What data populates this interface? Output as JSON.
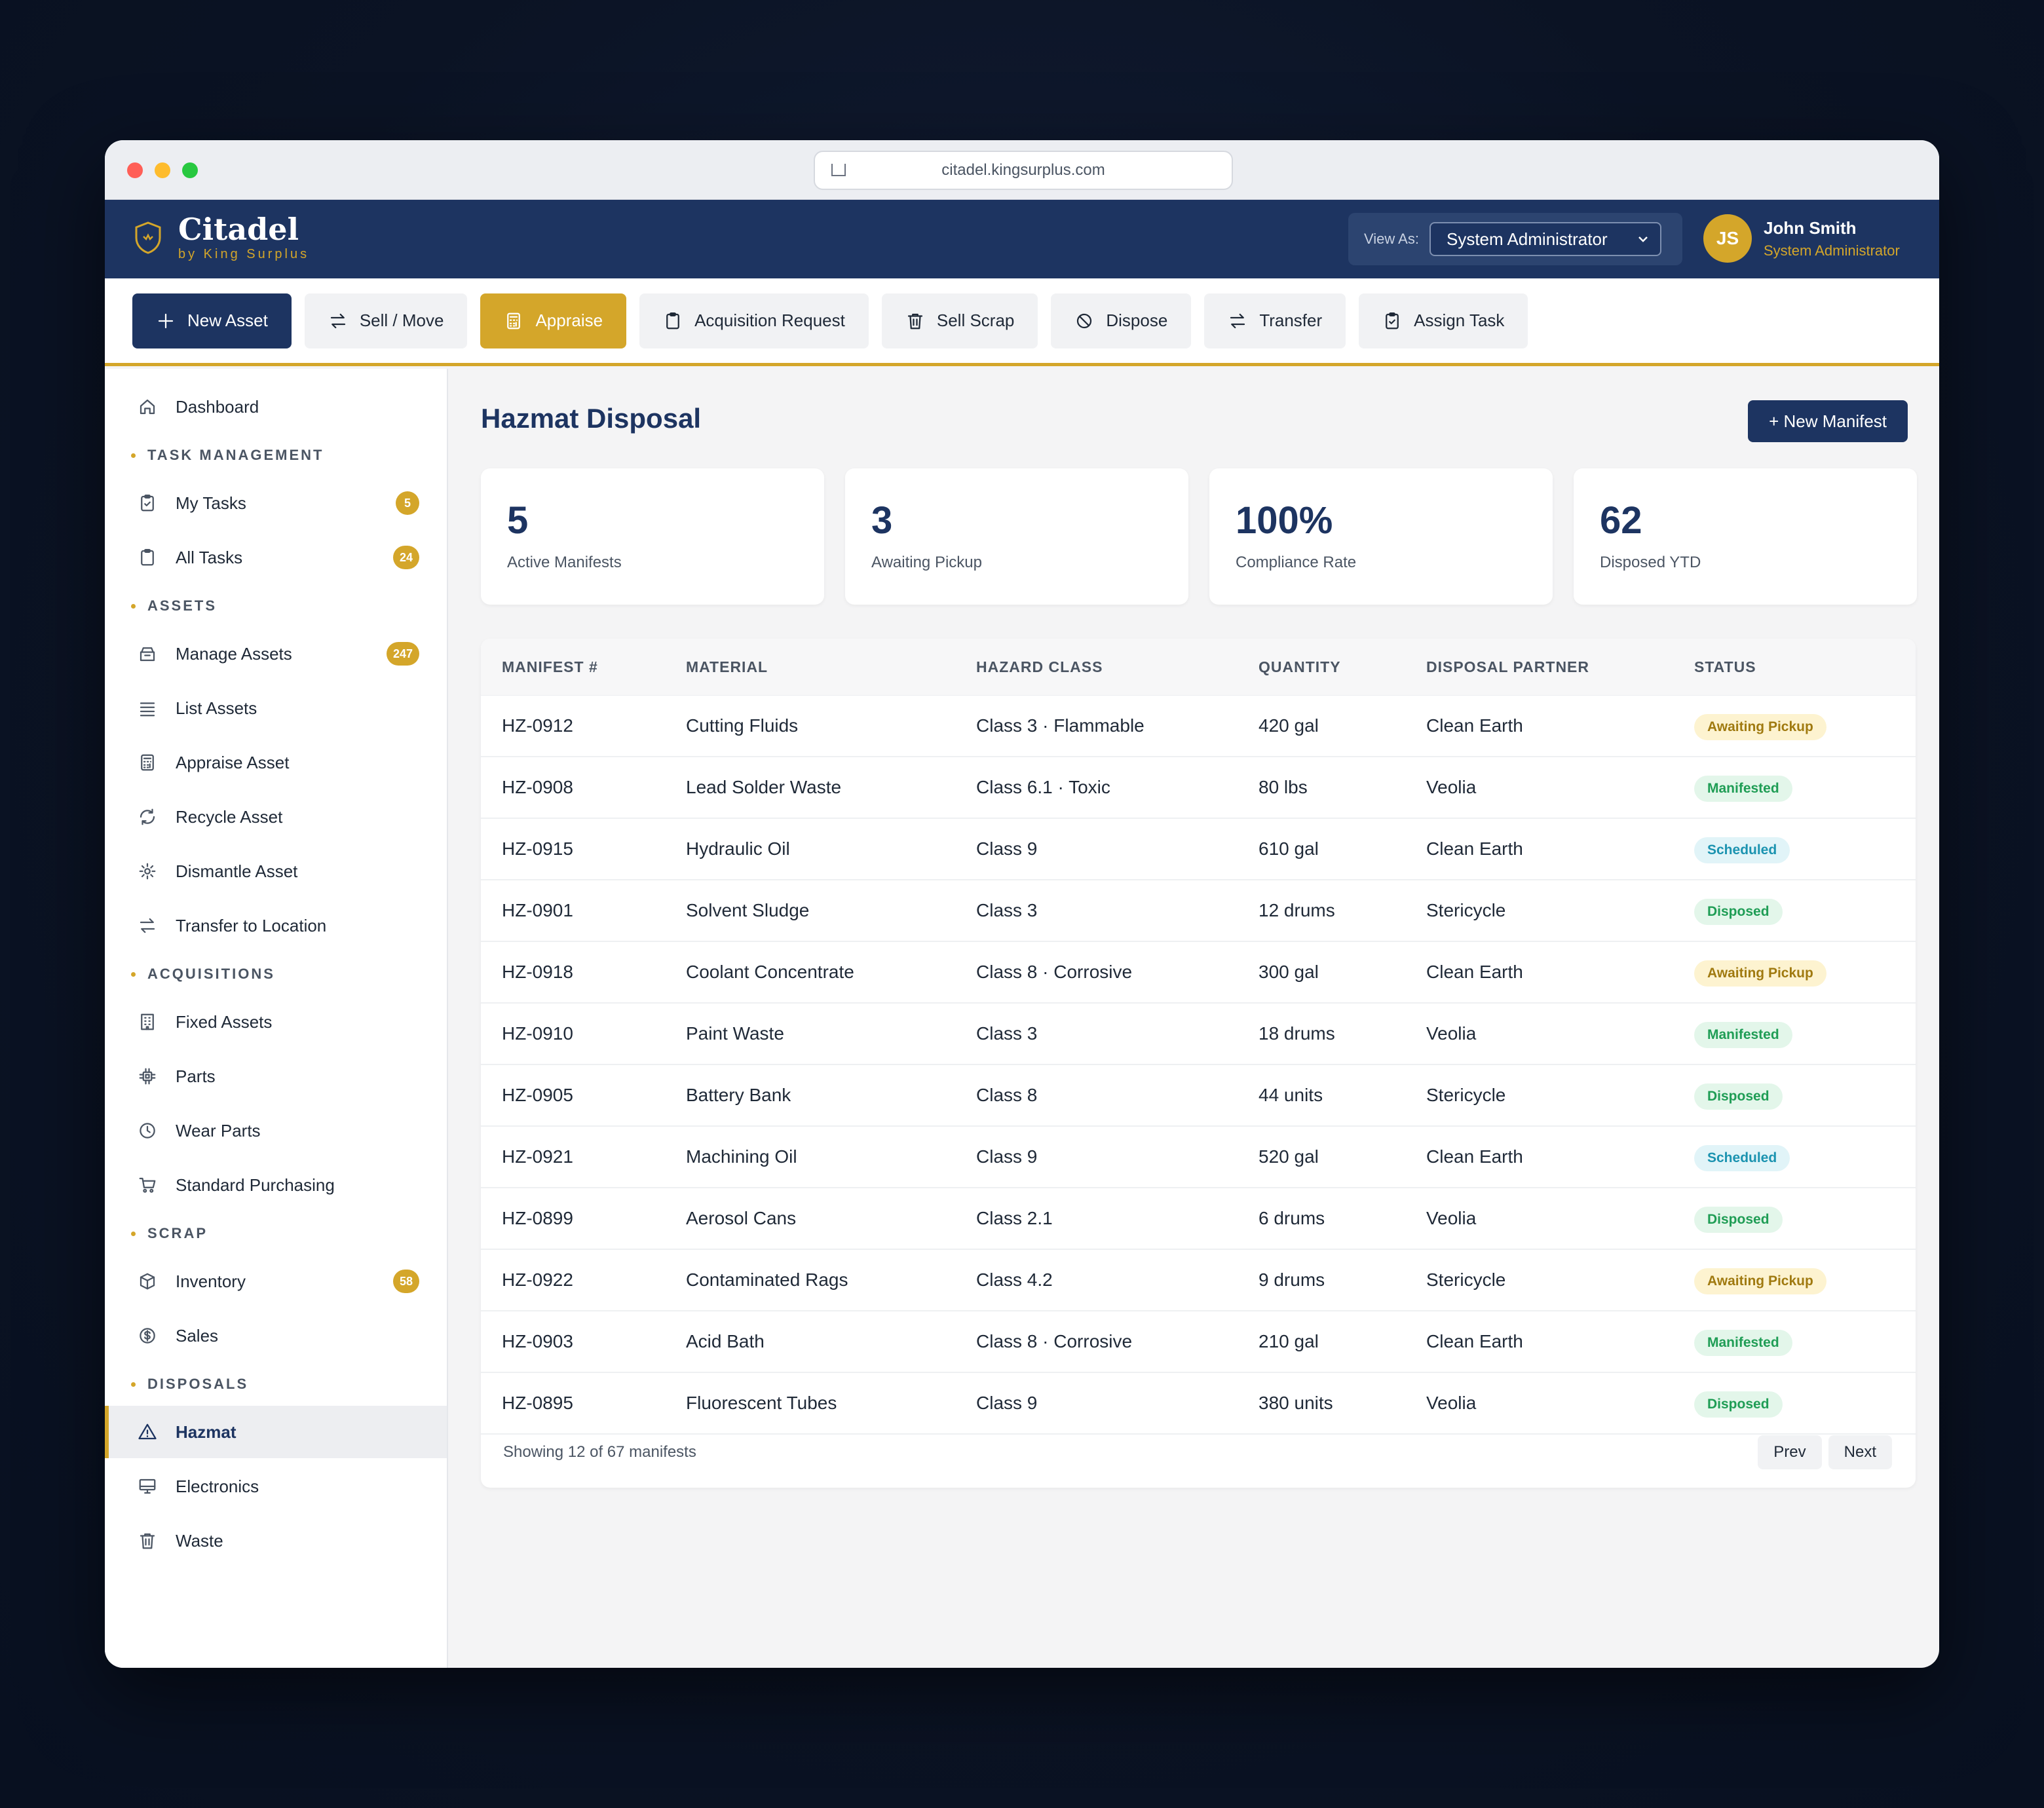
{
  "browser": {
    "url": "citadel.kingsurplus.com"
  },
  "header": {
    "brand_name": "Citadel",
    "brand_sub": "by King Surplus",
    "view_as_label": "View As:",
    "view_as_value": "System Administrator",
    "user_initials": "JS",
    "user_name": "John Smith",
    "user_role": "System Administrator"
  },
  "toolbar": [
    {
      "label": "New Asset",
      "icon": "plus-icon",
      "style": "primary"
    },
    {
      "label": "Sell / Move",
      "icon": "swap-icon",
      "style": "default"
    },
    {
      "label": "Appraise",
      "icon": "calculator-icon",
      "style": "gold"
    },
    {
      "label": "Acquisition Request",
      "icon": "clipboard-icon",
      "style": "default"
    },
    {
      "label": "Sell Scrap",
      "icon": "trash-icon",
      "style": "default"
    },
    {
      "label": "Dispose",
      "icon": "ban-icon",
      "style": "default"
    },
    {
      "label": "Transfer",
      "icon": "swap-icon",
      "style": "default"
    },
    {
      "label": "Assign Task",
      "icon": "clipboard-check-icon",
      "style": "default"
    }
  ],
  "sidebar": {
    "dashboard": "Dashboard",
    "sections": [
      {
        "title": "TASK MANAGEMENT",
        "items": [
          {
            "label": "My Tasks",
            "icon": "clipboard-check-icon",
            "badge": "5"
          },
          {
            "label": "All Tasks",
            "icon": "clipboard-icon",
            "badge": "24"
          }
        ]
      },
      {
        "title": "ASSETS",
        "items": [
          {
            "label": "Manage Assets",
            "icon": "archive-icon",
            "badge": "247"
          },
          {
            "label": "List Assets",
            "icon": "list-icon"
          },
          {
            "label": "Appraise Asset",
            "icon": "calculator-icon"
          },
          {
            "label": "Recycle Asset",
            "icon": "recycle-icon"
          },
          {
            "label": "Dismantle Asset",
            "icon": "gear-icon"
          },
          {
            "label": "Transfer to Location",
            "icon": "swap-icon"
          }
        ]
      },
      {
        "title": "ACQUISITIONS",
        "items": [
          {
            "label": "Fixed Assets",
            "icon": "building-icon"
          },
          {
            "label": "Parts",
            "icon": "chip-icon"
          },
          {
            "label": "Wear Parts",
            "icon": "clock-icon"
          },
          {
            "label": "Standard Purchasing",
            "icon": "cart-icon"
          }
        ]
      },
      {
        "title": "SCRAP",
        "items": [
          {
            "label": "Inventory",
            "icon": "box-icon",
            "badge": "58"
          },
          {
            "label": "Sales",
            "icon": "dollar-icon"
          }
        ]
      },
      {
        "title": "DISPOSALS",
        "items": [
          {
            "label": "Hazmat",
            "icon": "warning-icon",
            "active": true
          },
          {
            "label": "Electronics",
            "icon": "monitor-icon"
          },
          {
            "label": "Waste",
            "icon": "trash-icon"
          }
        ]
      }
    ]
  },
  "page": {
    "title": "Hazmat Disposal",
    "new_manifest_label": "+ New Manifest",
    "stats": [
      {
        "value": "5",
        "label": "Active Manifests"
      },
      {
        "value": "3",
        "label": "Awaiting Pickup"
      },
      {
        "value": "100%",
        "label": "Compliance Rate"
      },
      {
        "value": "62",
        "label": "Disposed YTD"
      }
    ]
  },
  "table": {
    "columns": [
      "MANIFEST #",
      "MATERIAL",
      "HAZARD CLASS",
      "QUANTITY",
      "DISPOSAL PARTNER",
      "STATUS"
    ],
    "rows": [
      [
        "HZ-0912",
        "Cutting Fluids",
        "Class 3 · Flammable",
        "420 gal",
        "Clean Earth",
        "Awaiting Pickup"
      ],
      [
        "HZ-0908",
        "Lead Solder Waste",
        "Class 6.1 · Toxic",
        "80 lbs",
        "Veolia",
        "Manifested"
      ],
      [
        "HZ-0915",
        "Hydraulic Oil",
        "Class 9",
        "610 gal",
        "Clean Earth",
        "Scheduled"
      ],
      [
        "HZ-0901",
        "Solvent Sludge",
        "Class 3",
        "12 drums",
        "Stericycle",
        "Disposed"
      ],
      [
        "HZ-0918",
        "Coolant Concentrate",
        "Class 8 · Corrosive",
        "300 gal",
        "Clean Earth",
        "Awaiting Pickup"
      ],
      [
        "HZ-0910",
        "Paint Waste",
        "Class 3",
        "18 drums",
        "Veolia",
        "Manifested"
      ],
      [
        "HZ-0905",
        "Battery Bank",
        "Class 8",
        "44 units",
        "Stericycle",
        "Disposed"
      ],
      [
        "HZ-0921",
        "Machining Oil",
        "Class 9",
        "520 gal",
        "Clean Earth",
        "Scheduled"
      ],
      [
        "HZ-0899",
        "Aerosol Cans",
        "Class 2.1",
        "6 drums",
        "Veolia",
        "Disposed"
      ],
      [
        "HZ-0922",
        "Contaminated Rags",
        "Class 4.2",
        "9 drums",
        "Stericycle",
        "Awaiting Pickup"
      ],
      [
        "HZ-0903",
        "Acid Bath",
        "Class 8 · Corrosive",
        "210 gal",
        "Clean Earth",
        "Manifested"
      ],
      [
        "HZ-0895",
        "Fluorescent Tubes",
        "Class 9",
        "380 units",
        "Veolia",
        "Disposed"
      ]
    ],
    "status_colors": {
      "Awaiting Pickup": {
        "bg": "#fdf3d0",
        "fg": "#a07a10"
      },
      "Manifested": {
        "bg": "#e3f6ea",
        "fg": "#1f9d55"
      },
      "Scheduled": {
        "bg": "#e1f4f8",
        "fg": "#1b93b0"
      },
      "Disposed": {
        "bg": "#e3f6ea",
        "fg": "#1f9d55"
      }
    },
    "footer_text": "Showing 12 of 67 manifests",
    "prev_label": "Prev",
    "next_label": "Next"
  },
  "colors": {
    "navy": "#1d3461",
    "gold": "#d4a62a"
  }
}
